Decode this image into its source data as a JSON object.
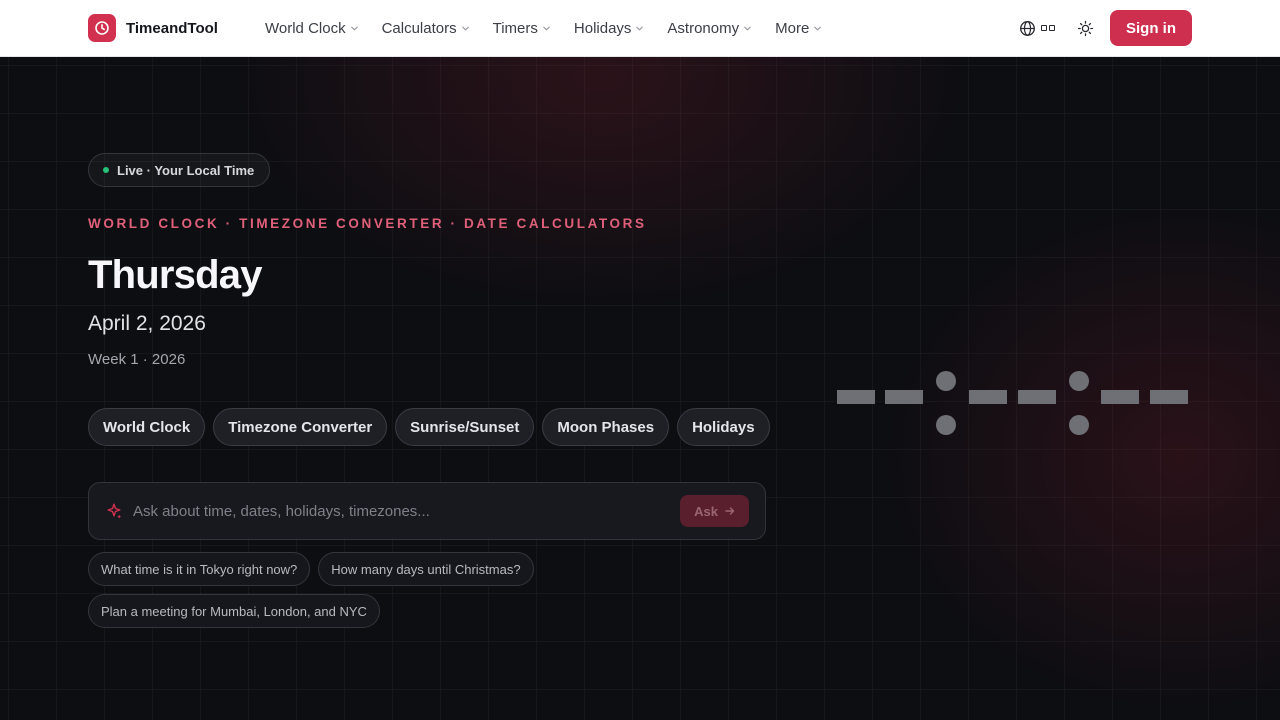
{
  "nav": {
    "brand": "TimeandTool",
    "items": [
      {
        "label": "World Clock",
        "name": "nav-world-clock"
      },
      {
        "label": "Calculators",
        "name": "nav-calculators"
      },
      {
        "label": "Timers",
        "name": "nav-timers"
      },
      {
        "label": "Holidays",
        "name": "nav-holidays"
      },
      {
        "label": "Astronomy",
        "name": "nav-astronomy"
      },
      {
        "label": "More",
        "name": "nav-more"
      }
    ],
    "sign_in": "Sign in"
  },
  "hero": {
    "live_label": "Live · Your Local Time",
    "eyebrow": "WORLD CLOCK · TIMEZONE CONVERTER · DATE CALCULATORS",
    "day": "Thursday",
    "date": "April 2, 2026",
    "week": "Week 1 · 2026",
    "chips": [
      {
        "label": "World Clock",
        "name": "chip-world-clock"
      },
      {
        "label": "Timezone Converter",
        "name": "chip-timezone-converter"
      },
      {
        "label": "Sunrise/Sunset",
        "name": "chip-sunrise-sunset"
      },
      {
        "label": "Moon Phases",
        "name": "chip-moon-phases"
      },
      {
        "label": "Holidays",
        "name": "chip-holidays"
      }
    ],
    "ask": {
      "placeholder": "Ask about time, dates, holidays, timezones...",
      "value": "",
      "button": "Ask"
    },
    "suggestions": [
      "What time is it in Tokyo right now?",
      "How many days until Christmas?",
      "Plan a meeting for Mumbai, London, and NYC"
    ]
  },
  "colors": {
    "accent": "#cf2f4f",
    "eyebrow": "#e0607a",
    "live_dot": "#27c17a",
    "background": "#0d0e12"
  },
  "icons": {
    "brand": "clock-icon",
    "language": "globe-icon",
    "theme": "sun-icon",
    "ask": "sparkle-icon",
    "ask_button": "arrow-right-icon"
  }
}
